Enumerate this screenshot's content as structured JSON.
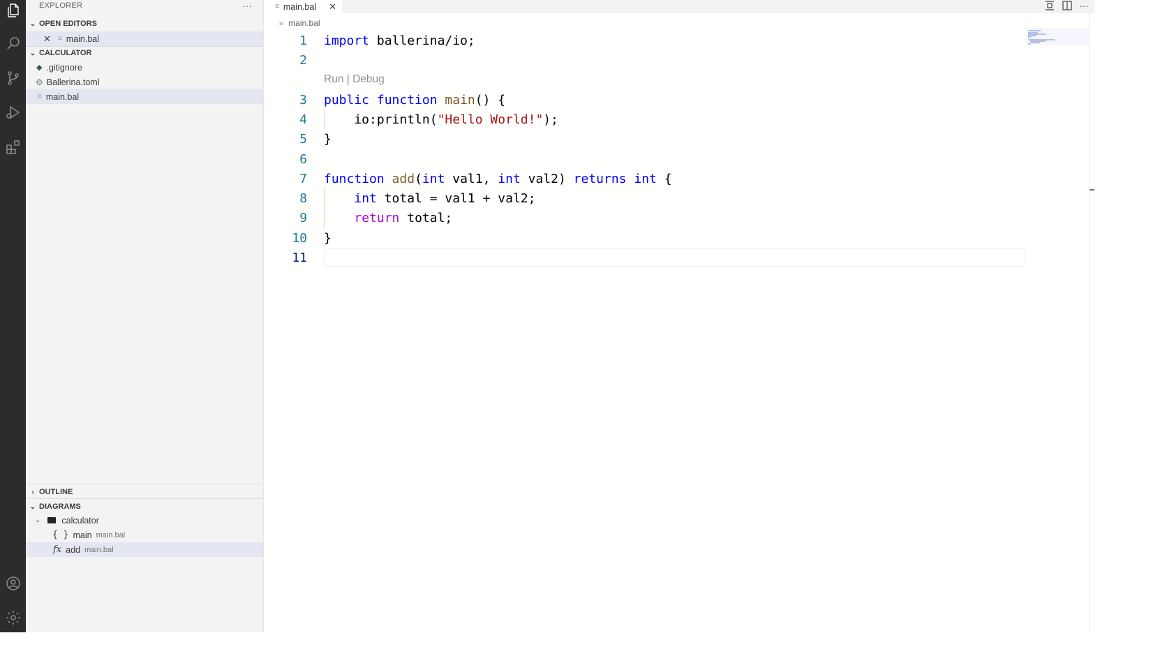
{
  "sidebar": {
    "title": "EXPLORER",
    "more": "···",
    "open_editors": {
      "header": "OPEN EDITORS",
      "items": [
        {
          "name": "main.bal"
        }
      ]
    },
    "calculator": {
      "header": "CALCULATOR",
      "files": [
        {
          "name": ".gitignore"
        },
        {
          "name": "Ballerina.toml"
        },
        {
          "name": "main.bal"
        }
      ]
    },
    "outline": {
      "header": "OUTLINE"
    },
    "diagrams": {
      "header": "DIAGRAMS",
      "folder": "calculator",
      "items": [
        {
          "name": "main",
          "file": "main.bal",
          "icon": "{ }"
        },
        {
          "name": "add",
          "file": "main.bal",
          "icon": "fx"
        }
      ]
    }
  },
  "editor": {
    "tab_label": "main.bal",
    "breadcrumb": "main.bal",
    "code_lens": "Run | Debug",
    "line_numbers": [
      "1",
      "2",
      "3",
      "4",
      "5",
      "6",
      "7",
      "8",
      "9",
      "10",
      "11"
    ],
    "code": {
      "l1_kw": "import",
      "l1_rest": " ballerina/io;",
      "l3_kw1": "public",
      "l3_kw2": "function",
      "l3_fn": "main",
      "l3_rest": "() {",
      "l4_pre": "    io:println(",
      "l4_str": "\"Hello World!\"",
      "l4_post": ");",
      "l5": "}",
      "l7_kw": "function",
      "l7_fn": "add",
      "l7_p1": "(",
      "l7_int1": "int",
      "l7_p2": " val1, ",
      "l7_int2": "int",
      "l7_p3": " val2) ",
      "l7_returns": "returns",
      "l7_int3": "int",
      "l7_p4": " {",
      "l8_int": "int",
      "l8_rest": " total = val1 + val2;",
      "l9_kw": "return",
      "l9_rest": " total;",
      "l10": "}"
    }
  },
  "colors": {
    "keyword": "#0000ff",
    "control": "#af00db",
    "function": "#795e26",
    "string": "#a31515",
    "line_number": "#237893",
    "activity_bar": "#2c2c2c"
  }
}
